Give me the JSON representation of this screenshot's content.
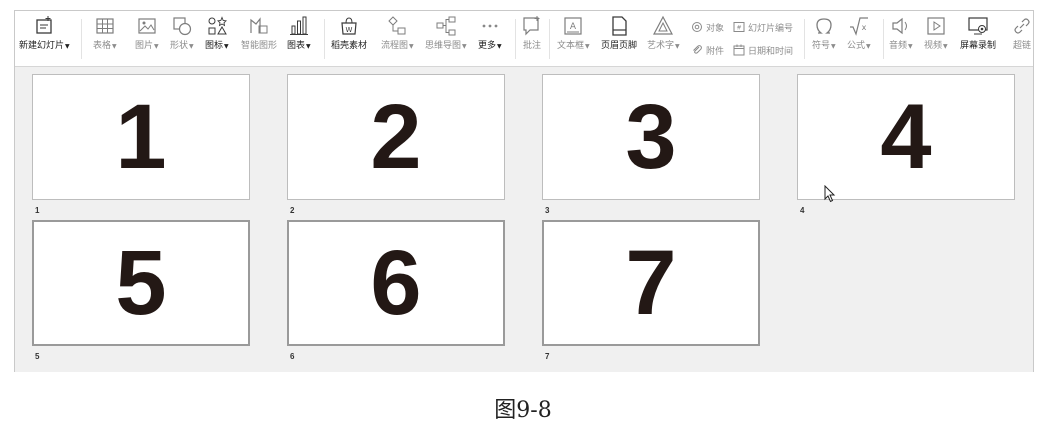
{
  "ribbon": {
    "new_slide": "新建幻灯片",
    "table": "表格",
    "picture": "图片",
    "shape": "形状",
    "icon": "图标",
    "smartart": "智能图形",
    "chart": "图表",
    "daoke": "稻壳素材",
    "flowchart": "流程图",
    "mindmap": "思维导图",
    "more": "更多",
    "comment": "批注",
    "textbox": "文本框",
    "header_footer": "页眉页脚",
    "wordart": "艺术字",
    "object": "对象",
    "slide_number": "幻灯片编号",
    "attachment": "附件",
    "datetime": "日期和时间",
    "symbol": "符号",
    "formula": "公式",
    "audio": "音频",
    "video": "视频",
    "screen_record": "屏幕录制",
    "hyperlink": "超链"
  },
  "slides": [
    {
      "content": "1",
      "label": "1"
    },
    {
      "content": "2",
      "label": "2"
    },
    {
      "content": "3",
      "label": "3"
    },
    {
      "content": "4",
      "label": "4"
    },
    {
      "content": "5",
      "label": "5"
    },
    {
      "content": "6",
      "label": "6"
    },
    {
      "content": "7",
      "label": "7"
    }
  ],
  "caption": "图9-8"
}
